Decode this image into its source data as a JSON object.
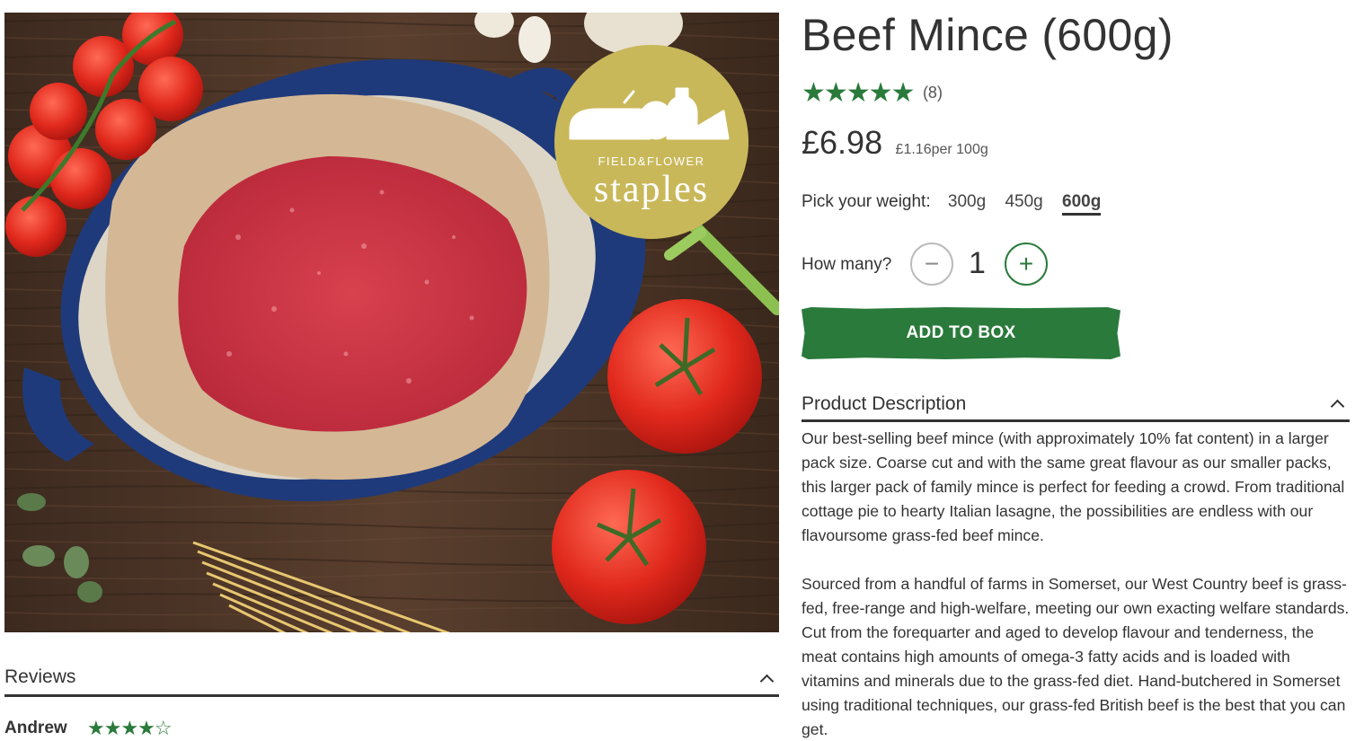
{
  "product": {
    "title": "Beef Mince (600g)",
    "rating_stars": "★★★★★",
    "rating_count": "(8)",
    "price": "£6.98",
    "unit_price": "£1.16per 100g",
    "image_badge": {
      "brand": "FIELD&FLOWER",
      "label": "staples"
    }
  },
  "weight": {
    "label": "Pick your weight:",
    "options": [
      "300g",
      "450g",
      "600g"
    ],
    "selected": "600g"
  },
  "quantity": {
    "label": "How many?",
    "minus": "−",
    "value": "1",
    "plus": "+"
  },
  "cta": {
    "add_to_box": "ADD TO BOX"
  },
  "description": {
    "heading": "Product Description",
    "paragraphs": [
      "Our best-selling beef mince (with approximately 10% fat content) in a larger pack size. Coarse cut and with the same great flavour as our smaller packs, this larger pack of family mince is perfect for feeding a crowd. From traditional cottage pie to hearty Italian lasagne, the possibilities are endless with our flavoursome grass-fed beef mince.",
      "Sourced from a handful of farms in Somerset, our West Country beef is grass-fed, free-range and high-welfare, meeting our own exacting welfare standards. Cut from the forequarter and aged to develop flavour and tenderness, the meat contains high amounts of omega-3 fatty acids and is loaded with vitamins and minerals due to the grass-fed diet. Hand-butchered in Somerset using traditional techniques, our grass-fed British beef is the best that you can get."
    ]
  },
  "reviews": {
    "heading": "Reviews",
    "items": [
      {
        "name": "Andrew",
        "stars": "★★★★☆",
        "rating": 4
      }
    ]
  },
  "colors": {
    "accent_green": "#2a7a3b",
    "badge_gold": "#c9b85a",
    "text": "#333333"
  },
  "icons": [
    "chevron-up-icon",
    "star-icon",
    "minus-icon",
    "plus-icon"
  ]
}
